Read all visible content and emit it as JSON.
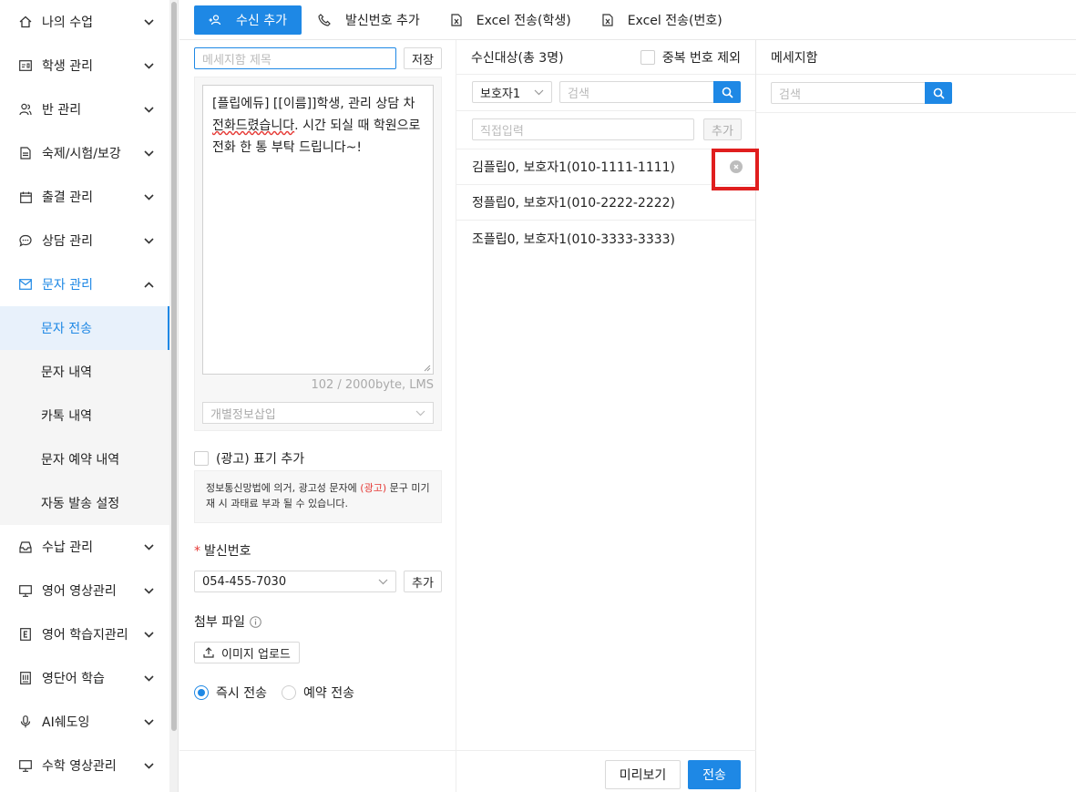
{
  "sidebar": {
    "items": [
      {
        "label": "나의 수업",
        "icon": "home-icon"
      },
      {
        "label": "학생 관리",
        "icon": "id-card-icon"
      },
      {
        "label": "반 관리",
        "icon": "people-icon"
      },
      {
        "label": "숙제/시험/보강",
        "icon": "document-icon"
      },
      {
        "label": "출결 관리",
        "icon": "calendar-icon"
      },
      {
        "label": "상담 관리",
        "icon": "chat-icon"
      },
      {
        "label": "문자 관리",
        "icon": "mail-icon"
      },
      {
        "label": "수납 관리",
        "icon": "inbox-icon"
      },
      {
        "label": "영어 영상관리",
        "icon": "monitor-icon"
      },
      {
        "label": "영어 학습지관리",
        "icon": "letter-e-icon"
      },
      {
        "label": "영단어 학습",
        "icon": "book-icon"
      },
      {
        "label": "AI쉐도잉",
        "icon": "microphone-icon"
      },
      {
        "label": "수학 영상관리",
        "icon": "monitor-icon"
      }
    ],
    "submenu": [
      "문자 전송",
      "문자 내역",
      "카톡 내역",
      "문자 예약 내역",
      "자동 발송 설정"
    ]
  },
  "toolbar": {
    "add_recipient": "수신 추가",
    "add_sender": "발신번호 추가",
    "excel_student": "Excel 전송(학생)",
    "excel_number": "Excel 전송(번호)"
  },
  "compose": {
    "title_placeholder": "메세지함 제목",
    "save_label": "저장",
    "message_part1": "[플립에듀] [[이름]]학생, 관리 상담 차 ",
    "message_part2": "전화드렸습니다",
    "message_part3": ". 시간 되실 때 학원으로 전화 한 통 부탁 드립니다~!",
    "byte_count": "102 / 2000byte, LMS",
    "personal_info_placeholder": "개별정보삽입",
    "ad_label": "(광고) 표기 추가",
    "notice_before": "정보통신망법에 의거, 광고성 문자에 ",
    "notice_red": "(광고)",
    "notice_after": " 문구 미기재 시 과태료 부과 될 수 있습니다.",
    "sender_label": "발신번호",
    "sender_number": "054-455-7030",
    "sender_add": "추가",
    "attach_label": "첨부 파일",
    "upload_label": "이미지 업로드",
    "send_now": "즉시 전송",
    "send_reserved": "예약 전송"
  },
  "recipients": {
    "header": "수신대상(총 3명)",
    "dedupe_label": "중복 번호 제외",
    "filter_value": "보호자1",
    "search_placeholder": "검색",
    "direct_placeholder": "직접입력",
    "add_label": "추가",
    "list": [
      "김플립0, 보호자1(010-1111-1111)",
      "정플립0, 보호자1(010-2222-2222)",
      "조플립0, 보호자1(010-3333-3333)"
    ]
  },
  "messages": {
    "header": "메세지함",
    "search_placeholder": "검색"
  },
  "bottom": {
    "preview": "미리보기",
    "send": "전송"
  },
  "colors": {
    "accent": "#1e88e5",
    "highlight": "#e01e1e"
  }
}
